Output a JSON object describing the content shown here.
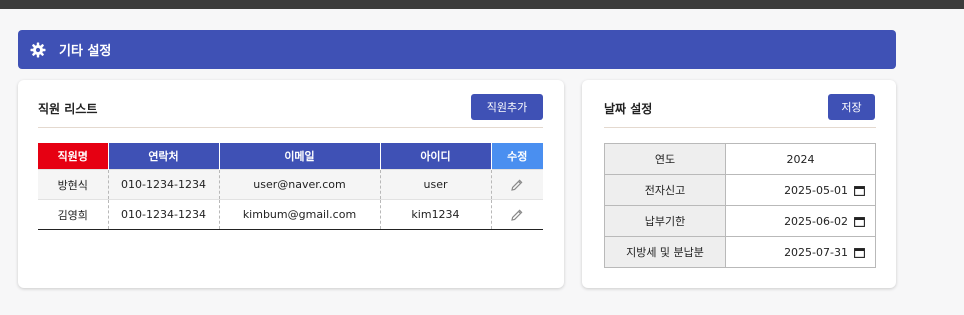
{
  "header": {
    "title": "기타 설정",
    "icon": "gear-icon"
  },
  "staff": {
    "title": "직원 리스트",
    "add_button": "직원추가",
    "columns": [
      "직원명",
      "연락처",
      "이메일",
      "아이디",
      "수정"
    ],
    "rows": [
      {
        "name": "방현식",
        "phone": "010-1234-1234",
        "email": "user@naver.com",
        "id": "user"
      },
      {
        "name": "김영희",
        "phone": "010-1234-1234",
        "email": "kimbum@gmail.com",
        "id": "kim1234"
      }
    ]
  },
  "dates": {
    "title": "날짜 설정",
    "save_button": "저장",
    "rows": [
      {
        "label": "연도",
        "value": "2024"
      },
      {
        "label": "전자신고",
        "value": "2025-05-01"
      },
      {
        "label": "납부기한",
        "value": "2025-06-02"
      },
      {
        "label": "지방세 및 분납분",
        "value": "2025-07-31"
      }
    ]
  },
  "colors": {
    "primary": "#3f51b5",
    "name_header": "#e60012",
    "edit_header": "#4a8ff0"
  }
}
